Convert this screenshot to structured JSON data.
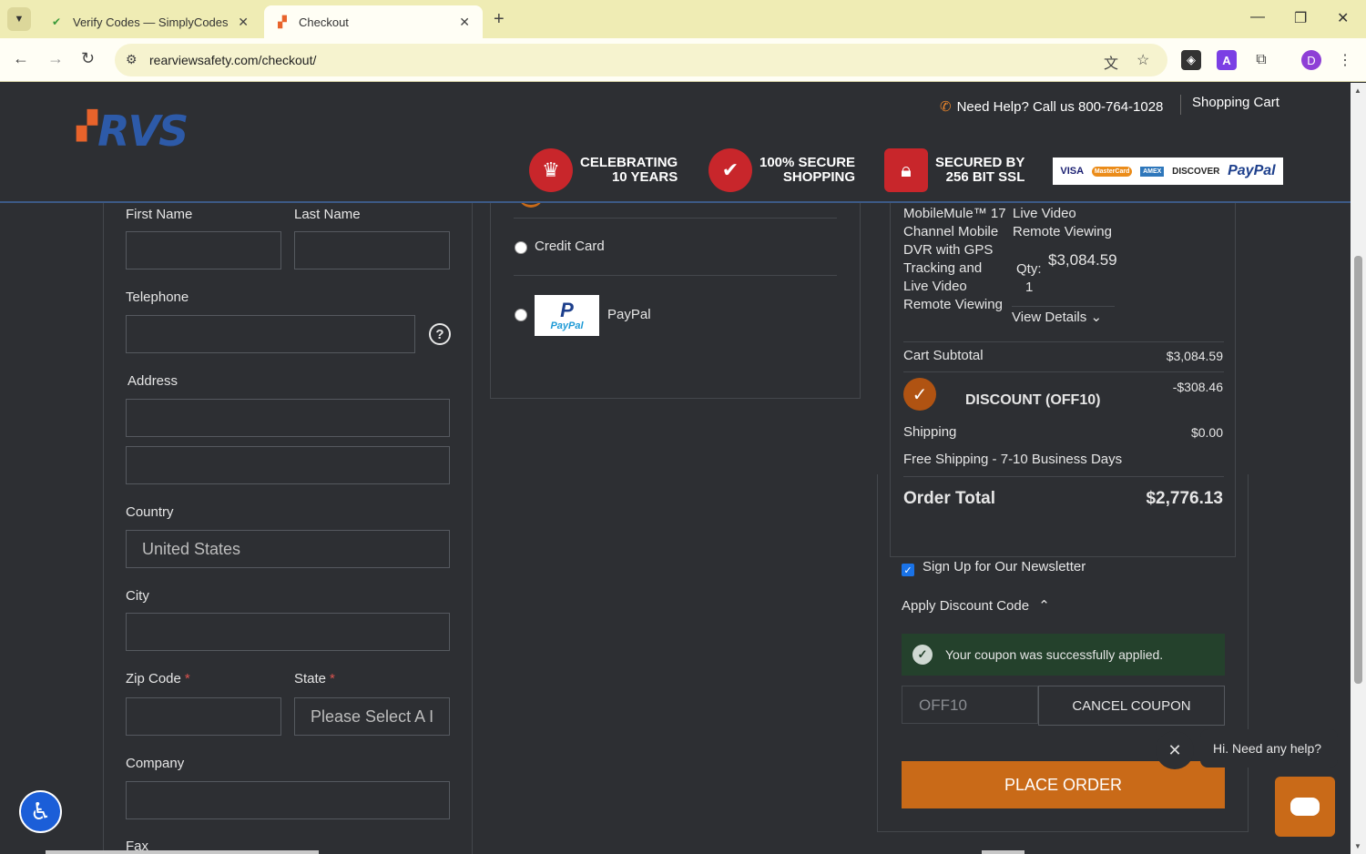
{
  "browser": {
    "tabs": [
      {
        "title": "Verify Codes — SimplyCodes",
        "favicon": "simplycodes-icon"
      },
      {
        "title": "Checkout",
        "favicon": "rvs-icon"
      }
    ],
    "url": "rearviewsafety.com/checkout/",
    "profile_initial": "D",
    "extension_letter": "A"
  },
  "header": {
    "logo_text": "RVS",
    "help_text": "Need Help? Call us 800-764-1028",
    "cart_link": "Shopping Cart",
    "badges": [
      {
        "line1": "CELEBRATING",
        "line2": "10 YEARS",
        "icon": "cake-icon"
      },
      {
        "line1": "100% SECURE",
        "line2": "SHOPPING",
        "icon": "shield-check-icon"
      },
      {
        "line1": "SECURED BY",
        "line2": "256 BIT SSL",
        "icon": "lock-card-icon"
      }
    ],
    "cards": [
      "VISA",
      "MasterCard",
      "AMEX",
      "DISCOVER",
      "PayPal"
    ]
  },
  "form": {
    "first_name_label": "First Name",
    "last_name_label": "Last Name",
    "telephone_label": "Telephone",
    "help_symbol": "?",
    "address_label": "Address",
    "country_label": "Country",
    "country_value": "United States",
    "city_label": "City",
    "zip_label": "Zip Code",
    "state_label": "State",
    "required_mark": "*",
    "state_placeholder": "Please Select A I",
    "company_label": "Company",
    "fax_label": "Fax"
  },
  "payment": {
    "options": [
      "Credit Card",
      "PayPal"
    ],
    "paypal_logo_top": "P",
    "paypal_logo_word": "PayPal"
  },
  "summary": {
    "product_name": "MobileMule™ 17 Channel Mobile DVR with GPS Tracking and Live Video Remote Viewing",
    "product_option": "Live Video Remote Viewing",
    "qty_label": "Qty:",
    "qty": "1",
    "price": "$3,084.59",
    "view_details": "View Details",
    "subtotal_label": "Cart Subtotal",
    "subtotal_value": "$3,084.59",
    "discount_label": "DISCOUNT (OFF10)",
    "discount_value": "-$308.46",
    "shipping_label": "Shipping",
    "shipping_value": "$0.00",
    "shipping_method": "Free Shipping - 7-10 Business Days",
    "total_label": "Order Total",
    "total_value": "$2,776.13"
  },
  "checkout": {
    "newsletter_label": "Sign Up for Our Newsletter",
    "newsletter_checked": true,
    "apply_discount_label": "Apply Discount Code",
    "success_message": "Your coupon was successfully applied.",
    "coupon_code": "OFF10",
    "cancel_coupon": "CANCEL COUPON",
    "place_order": "PLACE ORDER"
  },
  "chat": {
    "bubble": "Hi. Need any help?"
  },
  "colors": {
    "accent_orange": "#c96a18",
    "brand_blue": "#2d5aa8",
    "success_bg": "#24412c",
    "page_bg": "#2d2f33"
  }
}
